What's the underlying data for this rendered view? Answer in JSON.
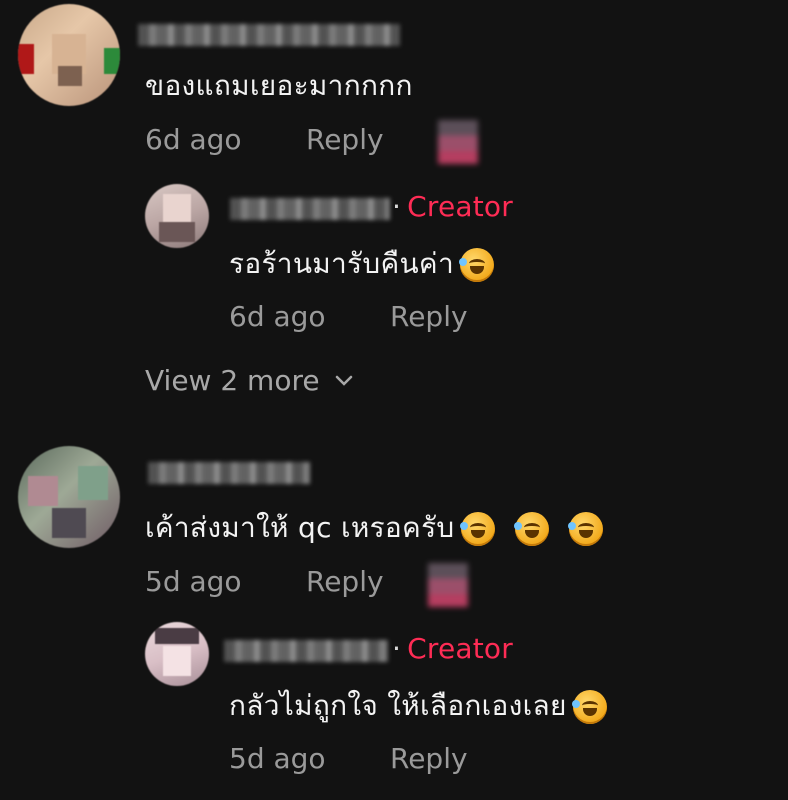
{
  "comments": [
    {
      "text": "ของแถมเยอะมากกกก",
      "time": "6d ago",
      "reply_label": "Reply",
      "replies": [
        {
          "creator_label": "Creator",
          "text": "รอร้านมารับคืนค่า",
          "time": "6d ago",
          "reply_label": "Reply"
        }
      ],
      "view_more_label": "View 2 more"
    },
    {
      "text": "เค้าส่งมาให้ qc เหรอครับ",
      "time": "5d ago",
      "reply_label": "Reply",
      "replies": [
        {
          "creator_label": "Creator",
          "text": "กลัวไม่ถูกใจ ให้เลือกเองเลย",
          "time": "5d ago",
          "reply_label": "Reply"
        }
      ]
    }
  ],
  "colors": {
    "background": "#121212",
    "creator_accent": "#fe2c55",
    "meta_text": "#9a9a9a"
  },
  "icons": {
    "emoji": "rolling-on-floor-laughing-emoji",
    "view_more": "chevron-down-icon"
  }
}
